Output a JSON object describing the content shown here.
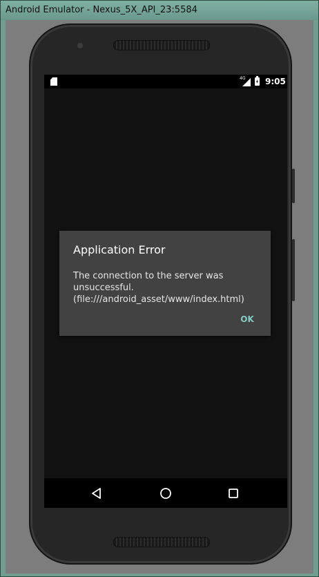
{
  "window": {
    "title": "Android Emulator - Nexus_5X_API_23:5584"
  },
  "status_bar": {
    "network": "4G",
    "time": "9:05",
    "icons": [
      "sd-card-icon",
      "signal-icon",
      "battery-charging-icon"
    ]
  },
  "dialog": {
    "title": "Application Error",
    "message": "The connection to the server was unsuccessful. (file:///android_asset/www/index.html)",
    "ok_label": "OK",
    "accent_color": "#80cbc4"
  },
  "nav_bar": {
    "icons": [
      "back-icon",
      "home-icon",
      "recents-icon"
    ]
  },
  "colors": {
    "screen_background": "#121212",
    "dialog_background": "#424242"
  }
}
